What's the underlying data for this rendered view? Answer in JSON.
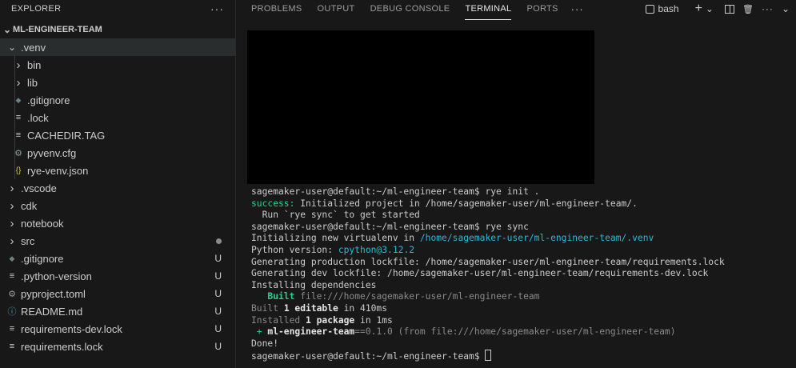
{
  "explorer": {
    "title": "EXPLORER",
    "more": "···",
    "root": "ML-ENGINEER-TEAM",
    "items": [
      {
        "label": ".venv",
        "indent": 1,
        "type": "folder-open",
        "icon": "chevron-down-icon",
        "selected": true,
        "status": ""
      },
      {
        "label": "bin",
        "indent": 2,
        "type": "folder",
        "icon": "chevron-right-icon",
        "status": ""
      },
      {
        "label": "lib",
        "indent": 2,
        "type": "folder",
        "icon": "chevron-right-icon",
        "status": ""
      },
      {
        "label": ".gitignore",
        "indent": 2,
        "type": "file",
        "icon": "git-icon",
        "status": ""
      },
      {
        "label": ".lock",
        "indent": 2,
        "type": "file",
        "icon": "lines-icon",
        "status": ""
      },
      {
        "label": "CACHEDIR.TAG",
        "indent": 2,
        "type": "file",
        "icon": "lines-icon",
        "status": ""
      },
      {
        "label": "pyvenv.cfg",
        "indent": 2,
        "type": "file",
        "icon": "gear-icon",
        "status": ""
      },
      {
        "label": "rye-venv.json",
        "indent": 2,
        "type": "file",
        "icon": "json-icon",
        "status": ""
      },
      {
        "label": ".vscode",
        "indent": 1,
        "type": "folder",
        "icon": "chevron-right-icon",
        "status": ""
      },
      {
        "label": "cdk",
        "indent": 1,
        "type": "folder",
        "icon": "chevron-right-icon",
        "status": ""
      },
      {
        "label": "notebook",
        "indent": 1,
        "type": "folder",
        "icon": "chevron-right-icon",
        "status": ""
      },
      {
        "label": "src",
        "indent": 1,
        "type": "folder",
        "icon": "chevron-right-icon",
        "status": "dot"
      },
      {
        "label": ".gitignore",
        "indent": 1,
        "type": "file",
        "icon": "git-icon",
        "status": "U"
      },
      {
        "label": ".python-version",
        "indent": 1,
        "type": "file",
        "icon": "lines-icon",
        "status": "U"
      },
      {
        "label": "pyproject.toml",
        "indent": 1,
        "type": "file",
        "icon": "gear-icon",
        "status": "U"
      },
      {
        "label": "README.md",
        "indent": 1,
        "type": "file",
        "icon": "info-icon",
        "status": "U"
      },
      {
        "label": "requirements-dev.lock",
        "indent": 1,
        "type": "file",
        "icon": "lines-icon",
        "status": "U"
      },
      {
        "label": "requirements.lock",
        "indent": 1,
        "type": "file",
        "icon": "lines-icon",
        "status": "U"
      }
    ]
  },
  "panel": {
    "tabs": [
      "PROBLEMS",
      "OUTPUT",
      "DEBUG CONSOLE",
      "TERMINAL",
      "PORTS"
    ],
    "active_tab": "TERMINAL",
    "more": "···",
    "shell": "bash",
    "add": "+",
    "chevron": "⌄",
    "trash": "🗑",
    "menu_more": "···",
    "collapse": "⌄"
  },
  "terminal": {
    "lines": [
      [
        {
          "t": "sagemaker-user@default:~/ml-engineer-team$ rye init .",
          "c": ""
        }
      ],
      [
        {
          "t": "success:",
          "c": "green"
        },
        {
          "t": " Initialized project in /home/sagemaker-user/ml-engineer-team/.",
          "c": ""
        }
      ],
      [
        {
          "t": "  Run `rye sync` to get started",
          "c": ""
        }
      ],
      [
        {
          "t": "sagemaker-user@default:~/ml-engineer-team$ rye sync",
          "c": ""
        }
      ],
      [
        {
          "t": "Initializing new virtualenv in ",
          "c": ""
        },
        {
          "t": "/home/sagemaker-user/ml-engineer-team/.venv",
          "c": "blue"
        }
      ],
      [
        {
          "t": "Python version: ",
          "c": ""
        },
        {
          "t": "cpython@3.12.2",
          "c": "blue"
        }
      ],
      [
        {
          "t": "Generating production lockfile: /home/sagemaker-user/ml-engineer-team/requirements.lock",
          "c": ""
        }
      ],
      [
        {
          "t": "Generating dev lockfile: /home/sagemaker-user/ml-engineer-team/requirements-dev.lock",
          "c": ""
        }
      ],
      [
        {
          "t": "Installing dependencies",
          "c": ""
        }
      ],
      [
        {
          "t": "   ",
          "c": ""
        },
        {
          "t": "Built",
          "c": "green bold"
        },
        {
          "t": " file:///home/sagemaker-user/ml-engineer-team",
          "c": "dim"
        }
      ],
      [
        {
          "t": "Built ",
          "c": "dim"
        },
        {
          "t": "1 editable",
          "c": "bright"
        },
        {
          "t": " in 410ms",
          "c": ""
        }
      ],
      [
        {
          "t": "Installed ",
          "c": "dim"
        },
        {
          "t": "1 package",
          "c": "bright"
        },
        {
          "t": " in 1ms",
          "c": ""
        }
      ],
      [
        {
          "t": " + ",
          "c": "green"
        },
        {
          "t": "ml-engineer-team",
          "c": "bright"
        },
        {
          "t": "==0.1.0 (from file:///home/sagemaker-user/ml-engineer-team)",
          "c": "dim"
        }
      ],
      [
        {
          "t": "Done!",
          "c": ""
        }
      ],
      [
        {
          "t": "sagemaker-user@default:~/ml-engineer-team$ ",
          "c": ""
        },
        {
          "t": "",
          "c": "cursor"
        }
      ]
    ]
  }
}
